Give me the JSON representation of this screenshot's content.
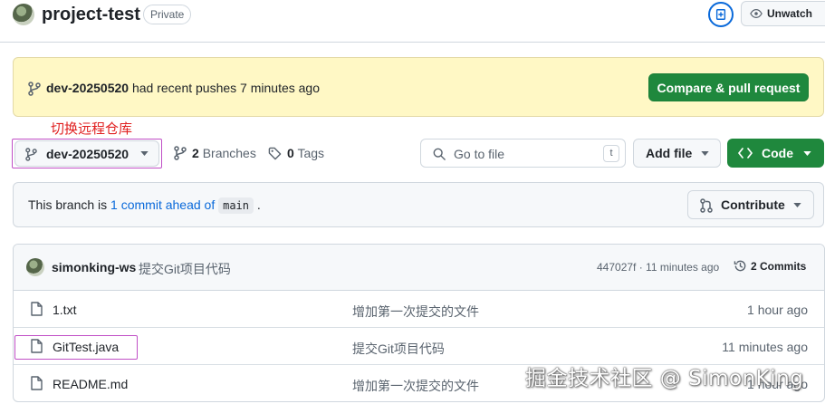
{
  "header": {
    "repo_name": "project-test",
    "visibility": "Private",
    "watch_label": "Unwatch"
  },
  "banner": {
    "branch": "dev-20250520",
    "text": " had recent pushes 7 minutes ago",
    "compare_label": "Compare & pull request"
  },
  "annotation": "切换远程仓库",
  "branch_bar": {
    "current_branch": "dev-20250520",
    "branches_count": "2",
    "branches_label": "Branches",
    "tags_count": "0",
    "tags_label": "Tags",
    "goto_placeholder": "Go to file",
    "goto_shortcut": "t",
    "add_file_label": "Add file",
    "code_label": "Code"
  },
  "ahead": {
    "prefix": "This branch is ",
    "link": "1 commit ahead of",
    "base_branch": "main",
    "suffix": ".",
    "contribute_label": "Contribute"
  },
  "latest_commit": {
    "author": "simonking-ws",
    "message": "提交Git项目代码",
    "hash_time": "447027f · 11 minutes ago",
    "commits_label": "2 Commits"
  },
  "files": [
    {
      "name": "1.txt",
      "message": "增加第一次提交的文件",
      "time": "1 hour ago"
    },
    {
      "name": "GitTest.java",
      "message": "提交Git项目代码",
      "time": "11 minutes ago"
    },
    {
      "name": "README.md",
      "message": "增加第一次提交的文件",
      "time": "1 hour ago"
    }
  ],
  "watermark": "掘金技术社区 @ SimonKing",
  "colors": {
    "accent": "#0969da",
    "primary_button": "#1f883d",
    "banner_bg": "#fff8c5",
    "annotation": "#e02020",
    "highlight_box": "#c04fc6"
  },
  "icons": {
    "branch": "git-branch-icon",
    "tag": "tag-icon",
    "search": "search-icon",
    "code": "code-icon",
    "contribute": "git-pull-request-icon",
    "history": "history-icon",
    "file": "file-icon",
    "eye": "eye-icon",
    "pin": "repo-pin-icon"
  }
}
